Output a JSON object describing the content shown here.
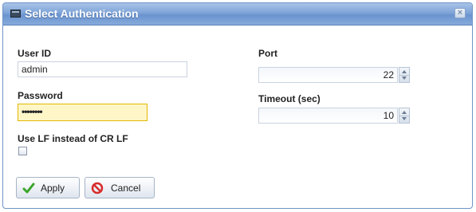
{
  "dialog": {
    "title": "Select Authentication",
    "close_symbol": "×"
  },
  "form": {
    "user_id": {
      "label": "User ID",
      "value": "admin"
    },
    "password": {
      "label": "Password",
      "value": "••••••••"
    },
    "lf_option": {
      "label": "Use LF instead of CR LF",
      "checked": false
    },
    "port": {
      "label": "Port",
      "value": "22"
    },
    "timeout": {
      "label": "Timeout (sec)",
      "value": "10"
    }
  },
  "buttons": {
    "apply": {
      "label": "Apply",
      "icon": "checkmark-icon"
    },
    "cancel": {
      "label": "Cancel",
      "icon": "cancel-icon"
    }
  },
  "colors": {
    "title_bar": "#7ea4d8",
    "focus_field": "#fff6c8",
    "apply_icon": "#3aa52a",
    "cancel_icon": "#d62b2b"
  }
}
